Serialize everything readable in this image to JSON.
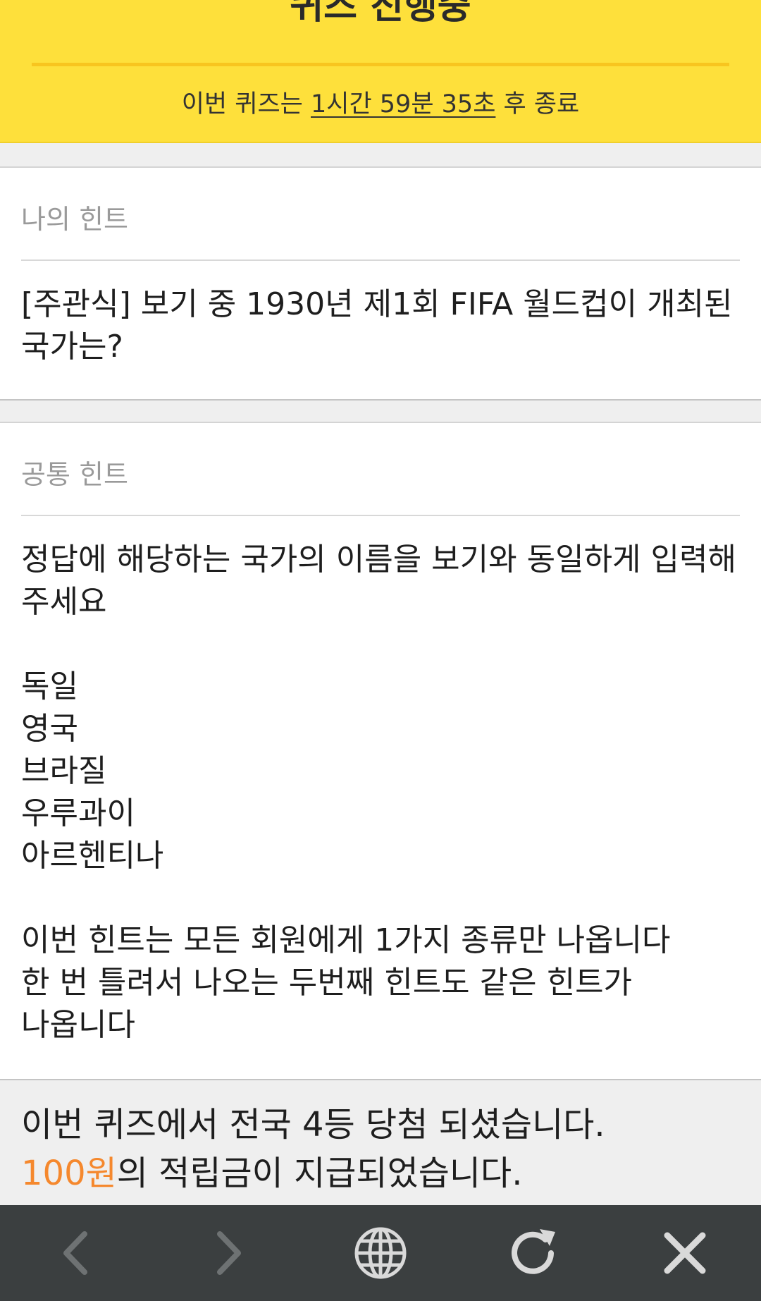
{
  "header": {
    "title": "퀴즈 진행중",
    "timer_prefix": "이번 퀴즈는 ",
    "timer_value": "1시간 59분 35초",
    "timer_suffix": " 후 종료"
  },
  "my_hint": {
    "label": "나의 힌트",
    "text": "[주관식] 보기 중 1930년 제1회 FIFA 월드컵이 개최된 국가는?"
  },
  "common_hint": {
    "label": "공통 힌트",
    "text": "정답에 해당하는 국가의 이름을 보기와 동일하게 입력해 주세요\n\n독일\n영국\n브라질\n우루과이\n아르헨티나\n\n이번 힌트는 모든 회원에게 1가지 종류만 나옵니다\n한 번 틀려서 나오는 두번째 힌트도 같은 힌트가 나옵니다"
  },
  "result": {
    "line1": "이번 퀴즈에서 전국 4등 당첨 되셨습니다.",
    "amount": "100원",
    "line2_suffix": "의 적립금이 지급되었습니다.",
    "amount_color": "#f5882d"
  },
  "toolbar": {
    "background": "#3b3f40",
    "icon_color": "#d9d9d9",
    "disabled_icon_color": "#6e7273",
    "buttons": [
      {
        "icon": "back-icon",
        "enabled": false
      },
      {
        "icon": "forward-icon",
        "enabled": false
      },
      {
        "icon": "globe-icon",
        "enabled": true
      },
      {
        "icon": "refresh-icon",
        "enabled": true
      },
      {
        "icon": "close-icon",
        "enabled": true
      }
    ]
  },
  "colors": {
    "header_background": "#fee03b",
    "header_divider": "#f8c51f",
    "page_background": "#efefef"
  }
}
